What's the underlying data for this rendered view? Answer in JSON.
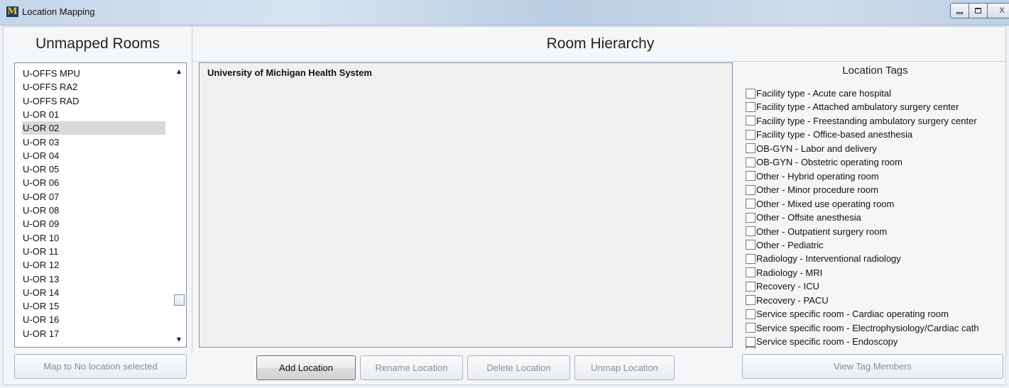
{
  "window": {
    "title": "Location Mapping",
    "icon_letter": "M",
    "controls": {
      "close_glyph": "X"
    }
  },
  "unmapped_rooms": {
    "header": "Unmapped Rooms",
    "items": [
      "U-OFFS MPU",
      "U-OFFS RA2",
      "U-OFFS RAD",
      "U-OR 01",
      "U-OR 02",
      "U-OR 03",
      "U-OR 04",
      "U-OR 05",
      "U-OR 06",
      "U-OR 07",
      "U-OR 08",
      "U-OR 09",
      "U-OR 10",
      "U-OR 11",
      "U-OR 12",
      "U-OR 13",
      "U-OR 14",
      "U-OR 15",
      "U-OR 16",
      "U-OR 17"
    ],
    "selected": "U-OR 02",
    "map_button": "Map to No location selected"
  },
  "room_hierarchy": {
    "header": "Room Hierarchy",
    "root": "University of Michigan Health System",
    "buttons": {
      "add": "Add Location",
      "rename": "Rename Location",
      "delete": "Delete Location",
      "unmap": "Unmap Location"
    }
  },
  "location_tags": {
    "title": "Location Tags",
    "items": [
      "Facility type - Acute care hospital",
      "Facility type - Attached ambulatory surgery center",
      "Facility type - Freestanding ambulatory surgery center",
      "Facility type - Office-based anesthesia",
      "OB-GYN - Labor and delivery",
      "OB-GYN - Obstetric operating room",
      "Other - Hybrid operating room",
      "Other - Minor procedure room",
      "Other - Mixed use operating room",
      "Other - Offsite anesthesia",
      "Other - Outpatient surgery room",
      "Other - Pediatric",
      "Radiology - Interventional radiology",
      "Radiology - MRI",
      "Recovery - ICU",
      "Recovery - PACU",
      "Service specific room - Cardiac operating room",
      "Service specific room - Electrophysiology/Cardiac cath",
      "Service specific room - Endoscopy"
    ],
    "view_button": "View Tag Members"
  }
}
